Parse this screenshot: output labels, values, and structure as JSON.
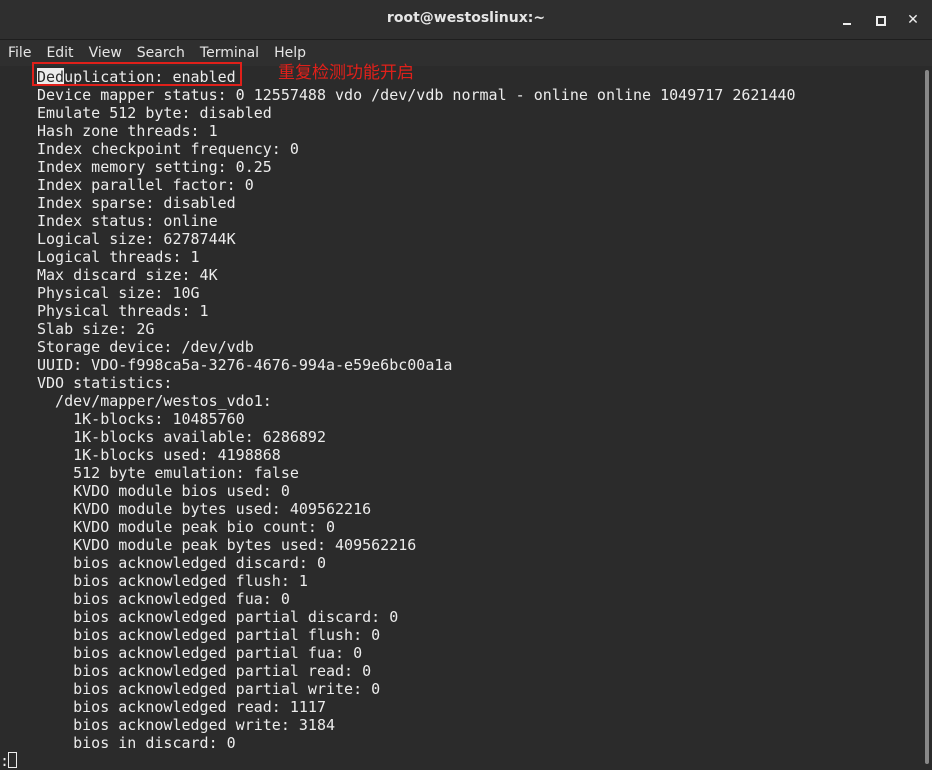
{
  "window": {
    "title": "root@westoslinux:~",
    "minimize_glyph": "",
    "maximize_glyph": "",
    "close_glyph": "✕"
  },
  "menu": [
    "File",
    "Edit",
    "View",
    "Search",
    "Terminal",
    "Help"
  ],
  "annotation": "重复检测功能开启",
  "first_line": {
    "selected": "Ded",
    "rest": "uplication: enabled"
  },
  "lines": [
    "Device mapper status: 0 12557488 vdo /dev/vdb normal - online online 1049717 2621440",
    "Emulate 512 byte: disabled",
    "Hash zone threads: 1",
    "Index checkpoint frequency: 0",
    "Index memory setting: 0.25",
    "Index parallel factor: 0",
    "Index sparse: disabled",
    "Index status: online",
    "Logical size: 6278744K",
    "Logical threads: 1",
    "Max discard size: 4K",
    "Physical size: 10G",
    "Physical threads: 1",
    "Slab size: 2G",
    "Storage device: /dev/vdb",
    "UUID: VDO-f998ca5a-3276-4676-994a-e59e6bc00a1a",
    "VDO statistics:",
    "  /dev/mapper/westos_vdo1:",
    "    1K-blocks: 10485760",
    "    1K-blocks available: 6286892",
    "    1K-blocks used: 4198868",
    "    512 byte emulation: false",
    "    KVDO module bios used: 0",
    "    KVDO module bytes used: 409562216",
    "    KVDO module peak bio count: 0",
    "    KVDO module peak bytes used: 409562216",
    "    bios acknowledged discard: 0",
    "    bios acknowledged flush: 1",
    "    bios acknowledged fua: 0",
    "    bios acknowledged partial discard: 0",
    "    bios acknowledged partial flush: 0",
    "    bios acknowledged partial fua: 0",
    "    bios acknowledged partial read: 0",
    "    bios acknowledged partial write: 0",
    "    bios acknowledged read: 1117",
    "    bios acknowledged write: 3184",
    "    bios in discard: 0"
  ],
  "prompt": ":",
  "colors": {
    "terminal_bg": "#2b2b2b",
    "text": "#ececec",
    "annotation_red": "#e0201a"
  }
}
